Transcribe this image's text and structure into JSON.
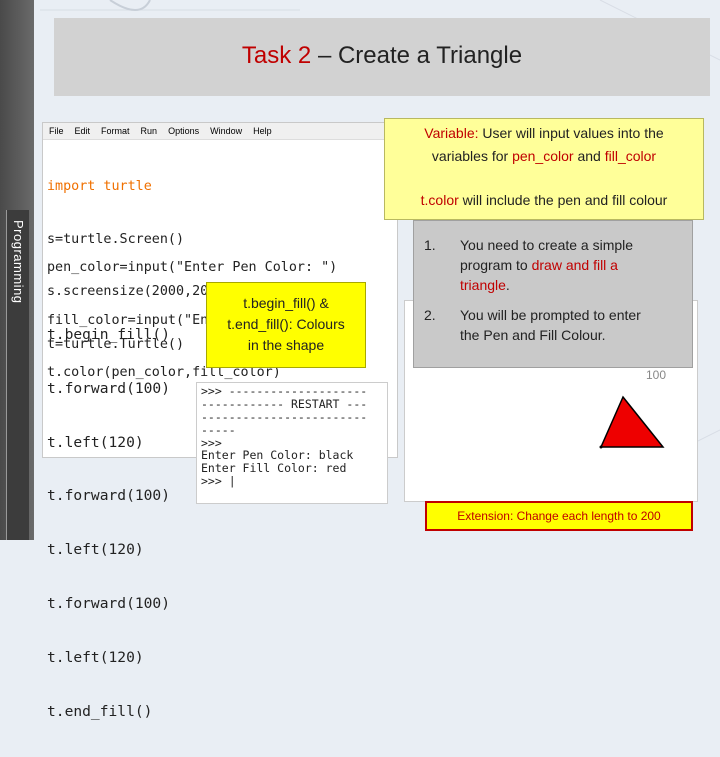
{
  "sidebar": {
    "label": "Programming"
  },
  "title": {
    "prefix": "Task 2",
    "suffix": " – Create a Triangle"
  },
  "code_window": {
    "menu": [
      "File",
      "Edit",
      "Format",
      "Run",
      "Options",
      "Window",
      "Help"
    ],
    "lines_top": [
      "import turtle",
      "s=turtle.Screen()",
      "s.screensize(2000,2000)",
      "t=turtle.Turtle()"
    ],
    "lines_input": [
      "pen_color=input(\"Enter Pen Color: \")",
      "fill_color=input(\"Enter Fill Color: \")",
      "t.color(pen_color,fill_color)"
    ],
    "lines_draw": [
      "t.begin_fill()",
      "t.forward(100)",
      "t.left(120)",
      "t.forward(100)",
      "t.left(120)",
      "t.forward(100)",
      "t.left(120)",
      "t.end_fill()"
    ]
  },
  "shell": {
    "lines": [
      ">>> --------------------",
      "------------ RESTART ---",
      "------------------------",
      "-----",
      ">>>",
      "Enter Pen Color: black",
      "Enter Fill Color: red",
      ">>> |"
    ]
  },
  "turtle_window": {
    "axis_value": "100",
    "triangle_fill": "#ee0000",
    "triangle_stroke": "#000000"
  },
  "variable_box": {
    "label": "Variable:",
    "line1_rest": " User will input values into the",
    "line2_a": "variables for ",
    "line2_b": "pen_color",
    "line2_c": " and ",
    "line2_d": "fill_color",
    "line3_a": "t.color",
    "line3_b": " will include the pen and fill colour"
  },
  "task_box": {
    "items": [
      {
        "number": "1.",
        "a": "You need to create a simple",
        "b": "program to ",
        "c": "draw and fill a",
        "d": "triangle",
        "e": "."
      },
      {
        "number": "2.",
        "a": "You will be prompted to enter",
        "b": "the Pen and Fill Colour."
      }
    ]
  },
  "note_box": {
    "line1": "t.begin_fill() &",
    "line2": "t.end_fill(): Colours",
    "line3": "in the shape"
  },
  "extension": {
    "text": "Extension: Change each length to 200"
  },
  "colors": {
    "accent_red": "#c00000",
    "note_yellow": "#ffff00",
    "var_yellow": "#ffff99"
  }
}
